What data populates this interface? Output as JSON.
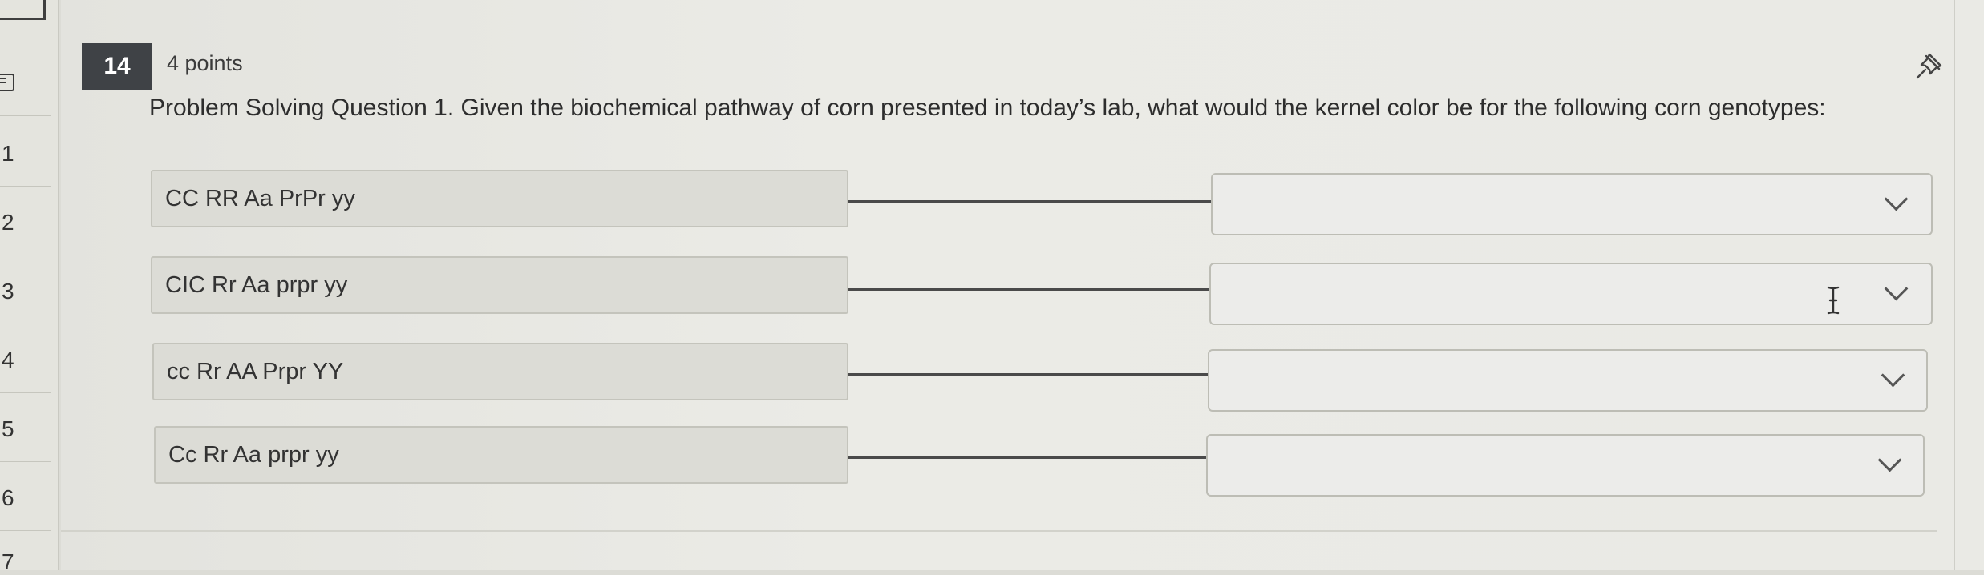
{
  "rail": {
    "numbers": [
      "1",
      "2",
      "3",
      "4",
      "5",
      "6",
      "7"
    ]
  },
  "question": {
    "number": "14",
    "points": "4 points",
    "text": "Problem Solving Question 1. Given the biochemical pathway of corn presented in today’s lab, what would the kernel color be for the following corn genotypes:"
  },
  "matches": [
    {
      "genotype": "CC RR Aa PrPr yy",
      "selected": ""
    },
    {
      "genotype": "CIC Rr Aa prpr yy",
      "selected": ""
    },
    {
      "genotype": "cc Rr AA Prpr YY",
      "selected": ""
    },
    {
      "genotype": "Cc Rr Aa prpr yy",
      "selected": ""
    }
  ],
  "icons": {
    "pin": "pin-icon",
    "dropdown": "chevron-down-icon",
    "list": "list-icon",
    "cursor": "text-cursor-icon"
  }
}
